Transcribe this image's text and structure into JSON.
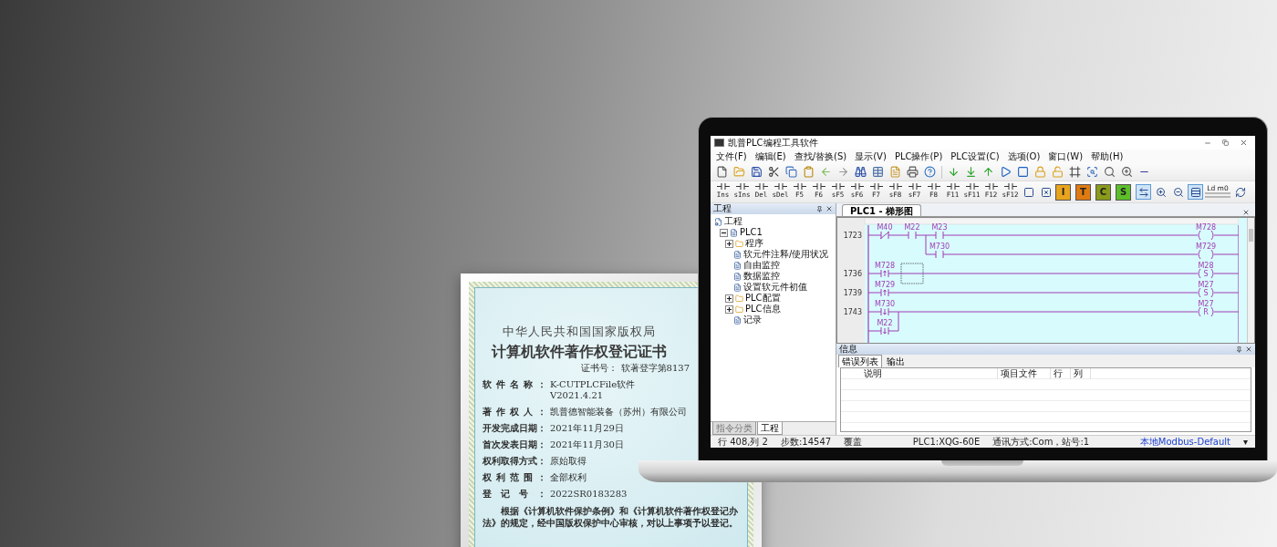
{
  "certificate": {
    "heading": "中华人民共和国国家版权局",
    "title": "计算机软件著作权登记证书",
    "number": "证书号： 软著登字第8137",
    "fields": [
      {
        "label": "软件名称：",
        "values": [
          "K-CUTPLCFile软件",
          "V2021.4.21"
        ]
      },
      {
        "label": "著作权人：",
        "values": [
          "凯普德智能装备（苏州）有限公司"
        ]
      },
      {
        "label": "开发完成日期：",
        "values": [
          "2021年11月29日"
        ]
      },
      {
        "label": "首次发表日期：",
        "values": [
          "2021年11月30日"
        ]
      },
      {
        "label": "权利取得方式：",
        "values": [
          "原始取得"
        ]
      },
      {
        "label": "权利范围：",
        "values": [
          "全部权利"
        ]
      },
      {
        "label": "登记号：",
        "values": [
          "2022SR0183283"
        ]
      }
    ],
    "paragraph": "根据《计算机软件保护条例》和《计算机软件著作权登记办法》的规定，经中国版权保护中心审核，对以上事项予以登记。"
  },
  "window": {
    "title": "凯普PLC编程工具软件",
    "menu": [
      "文件(F)",
      "编辑(E)",
      "查找/替换(S)",
      "显示(V)",
      "PLC操作(P)",
      "PLC设置(C)",
      "选项(O)",
      "窗口(W)",
      "帮助(H)"
    ],
    "toolbar_2": [
      {
        "kind": "key",
        "label": "Ins"
      },
      {
        "kind": "key",
        "label": "sIns"
      },
      {
        "kind": "key",
        "label": "Del"
      },
      {
        "kind": "key",
        "label": "sDel"
      },
      {
        "kind": "key",
        "label": "F5"
      },
      {
        "kind": "key",
        "label": "F6"
      },
      {
        "kind": "key",
        "label": "sF5"
      },
      {
        "kind": "key",
        "label": "sF6"
      },
      {
        "kind": "key",
        "label": "F7"
      },
      {
        "kind": "key",
        "label": "sF8"
      },
      {
        "kind": "key",
        "label": "sF7"
      },
      {
        "kind": "key",
        "label": "F8"
      },
      {
        "kind": "key",
        "label": "F11"
      },
      {
        "kind": "key",
        "label": "sF11"
      },
      {
        "kind": "key",
        "label": "F12"
      },
      {
        "kind": "key",
        "label": "sF12"
      },
      {
        "kind": "tool",
        "pressed": false
      },
      {
        "kind": "tool",
        "pressed": false
      },
      {
        "kind": "letter",
        "label": "I",
        "color": "#e8a41c"
      },
      {
        "kind": "letter",
        "label": "T",
        "color": "#e07a10"
      },
      {
        "kind": "letter",
        "label": "C",
        "color": "#8a9a1a"
      },
      {
        "kind": "letter",
        "label": "S",
        "color": "#5cbf2a"
      },
      {
        "kind": "tool",
        "pressed": true
      },
      {
        "kind": "tool",
        "pressed": false
      },
      {
        "kind": "tool",
        "pressed": false
      },
      {
        "kind": "tool",
        "pressed": true
      },
      {
        "kind": "ld",
        "label": "Ld m0"
      },
      {
        "kind": "tool",
        "pressed": false
      }
    ],
    "project_panel": {
      "title": "工程",
      "tree": [
        {
          "label": "工程",
          "children": [
            {
              "label": "PLC1",
              "expanded": true,
              "children": [
                {
                  "label": "程序",
                  "expanded": false
                },
                {
                  "label": "软元件注释/使用状况"
                },
                {
                  "label": "自由监控"
                },
                {
                  "label": "数据监控"
                },
                {
                  "label": "设置软元件初值"
                },
                {
                  "label": "PLC配置",
                  "expanded": false
                },
                {
                  "label": "PLC信息",
                  "expanded": false
                },
                {
                  "label": "记录"
                }
              ]
            }
          ]
        }
      ],
      "tabs": [
        {
          "label": "指令分类",
          "selected": false
        },
        {
          "label": "工程",
          "selected": true
        }
      ]
    },
    "document_tabs": [
      {
        "label": "PLC1 - 梯形图",
        "selected": true
      }
    ],
    "ladder": {
      "rows": [
        {
          "step": "1723",
          "elements": [
            {
              "kind": "nc",
              "label": "M40"
            },
            {
              "kind": "no",
              "label": "M22"
            },
            {
              "kind": "no",
              "label": "M23"
            }
          ],
          "coil": {
            "label": "M728"
          },
          "parallel": [
            {
              "elements": [
                {
                  "kind": "blank"
                },
                {
                  "kind": "blank"
                },
                {
                  "kind": "no",
                  "label": "M730"
                }
              ],
              "coil": {
                "label": "M729"
              }
            }
          ]
        },
        {
          "step": "1736",
          "elements": [
            {
              "kind": "rise",
              "label": "M728"
            },
            {
              "kind": "blank",
              "cursor": true
            }
          ],
          "coil": {
            "label": "M28",
            "op": "S"
          }
        },
        {
          "step": "1739",
          "elements": [
            {
              "kind": "rise",
              "label": "M729"
            }
          ],
          "coil": {
            "label": "M27",
            "op": "S"
          }
        },
        {
          "step": "1743",
          "elements": [
            {
              "kind": "fall",
              "label": "M730"
            }
          ],
          "coil": {
            "label": "M27",
            "op": "R"
          },
          "parallel": [
            {
              "elements": [
                {
                  "kind": "fall",
                  "label": "M22"
                }
              ]
            }
          ]
        }
      ]
    },
    "info_panel": {
      "title": "信息",
      "tabs": [
        {
          "label": "错误列表",
          "selected": true
        },
        {
          "label": "输出",
          "selected": false
        }
      ],
      "columns": [
        "说明",
        "项目文件",
        "行",
        "列"
      ]
    },
    "status_bar": [
      "行 408,列 2",
      "步数:14547",
      "覆盖",
      "PLC1:XQG-60E",
      "通讯方式:Com，站号:1",
      "本地Modbus-Default",
      "▾"
    ]
  }
}
